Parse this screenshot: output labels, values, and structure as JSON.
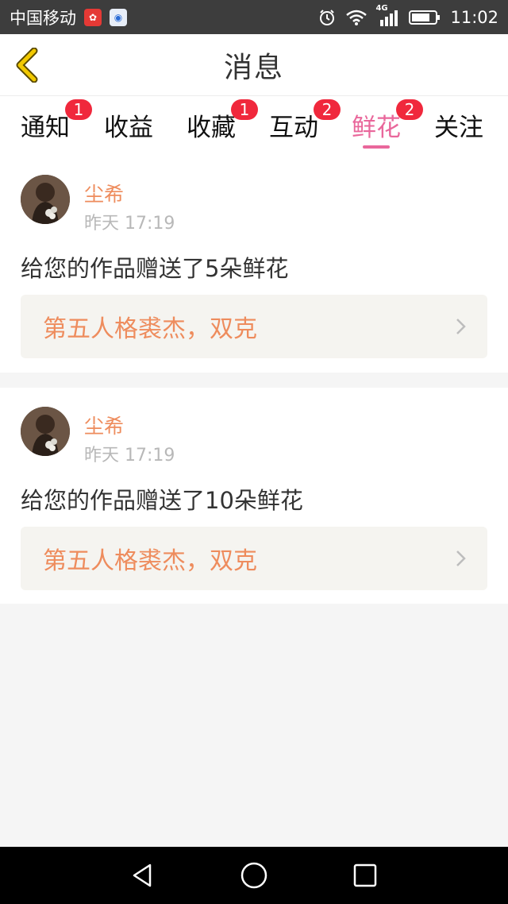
{
  "status_bar": {
    "carrier": "中国移动",
    "network": "4G",
    "time": "11:02"
  },
  "header": {
    "title": "消息",
    "back_icon": "chevron-left-icon",
    "accent": "#e9c400"
  },
  "tabs": [
    {
      "label": "通知",
      "badge": "1"
    },
    {
      "label": "收益",
      "badge": ""
    },
    {
      "label": "收藏",
      "badge": "1"
    },
    {
      "label": "互动",
      "badge": "2"
    },
    {
      "label": "鲜花",
      "badge": "2",
      "active": true
    },
    {
      "label": "关注",
      "badge": ""
    }
  ],
  "messages": [
    {
      "sender": "尘希",
      "time": "昨天 17:19",
      "text": "给您的作品赠送了5朵鲜花",
      "work_title": "第五人格裘杰，双克"
    },
    {
      "sender": "尘希",
      "time": "昨天 17:19",
      "text": "给您的作品赠送了10朵鲜花",
      "work_title": "第五人格裘杰，双克"
    }
  ],
  "colors": {
    "active_tab": "#e9679b",
    "badge": "#f0283c",
    "sender": "#ee8c5d",
    "link_bg": "#f5f4f0"
  }
}
